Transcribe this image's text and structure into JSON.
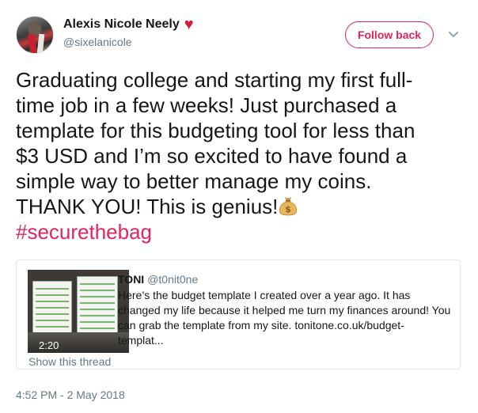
{
  "author": {
    "display_name": "Alexis Nicole Neely",
    "handle": "@sixelanicole",
    "name_emoji": "heart-icon"
  },
  "follow_button": {
    "label": "Follow back"
  },
  "tweet": {
    "lines": [
      "Graduating college and starting my first full-",
      "time job in a few weeks! Just purchased a",
      "template for this budgeting tool for less than",
      "$3 USD and I’m so excited to have found a",
      "simple way to better manage my coins.",
      "THANK YOU! This is genius!"
    ],
    "trailing_emoji": "moneybag-icon",
    "hashtag": "#securethebag"
  },
  "quoted_tweet": {
    "name": "TONI",
    "handle": "@t0nit0ne",
    "body_lines": [
      "Here’s the budget template I created over a year ago. It has",
      "changed my life because it helped me turn my finances around! You",
      "can grab the template from my site. tonitone.co.uk/budget-",
      "templat..."
    ],
    "video_duration": "2:20",
    "show_thread": "Show this thread"
  },
  "timestamp": "4:52 PM - 2 May 2018",
  "colors": {
    "accent": "#e0245e",
    "secondary_text": "#657786",
    "border": "#e1e8ed",
    "heart": "#d01f3c"
  }
}
